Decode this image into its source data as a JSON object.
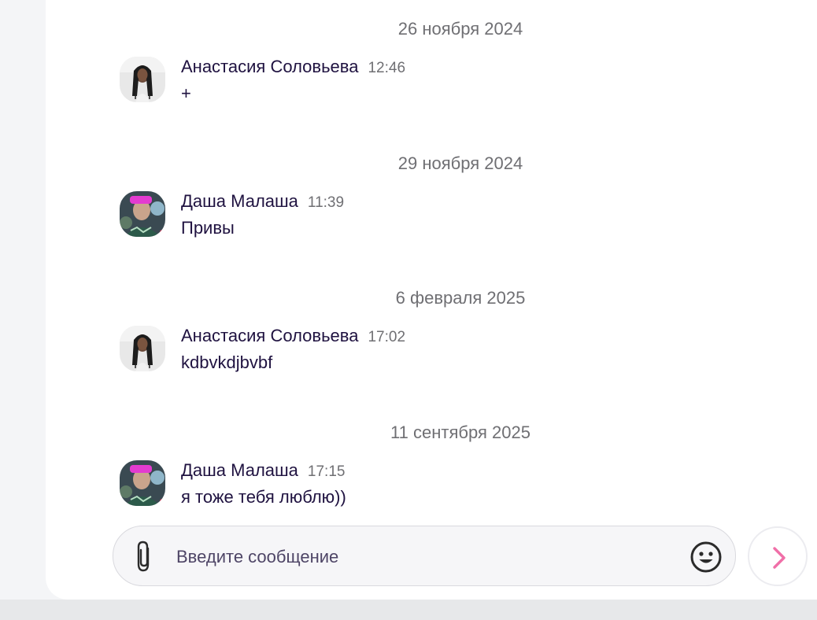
{
  "messages": [
    {
      "date": "26 ноября 2024",
      "author": "Анастасия Соловьева",
      "time": "12:46",
      "text": "+",
      "avatar": "avatar-anastasia"
    },
    {
      "date": "29 ноября 2024",
      "author": "Даша Малаша",
      "time": "11:39",
      "text": "Привы",
      "avatar": "avatar-dasha"
    },
    {
      "date": "6 февраля 2025",
      "author": "Анастасия Соловьева",
      "time": "17:02",
      "text": "kdbvkdjbvbf",
      "avatar": "avatar-anastasia"
    },
    {
      "date": "11 сентября 2025",
      "author": "Даша Малаша",
      "time": "17:15",
      "text": "я тоже тебя люблю))",
      "avatar": "avatar-dasha"
    }
  ],
  "composer": {
    "placeholder": "Введите сообщение",
    "value": "",
    "attach_icon": "paperclip-icon",
    "emoji_icon": "smiley-icon",
    "send_icon": "chevron-right-icon"
  },
  "colors": {
    "author_text": "#1f1240",
    "secondary_text": "#6f6f73",
    "send_accent": "#f06fa8",
    "panel_bg": "#ffffff",
    "page_bg": "#f4f5f7"
  }
}
